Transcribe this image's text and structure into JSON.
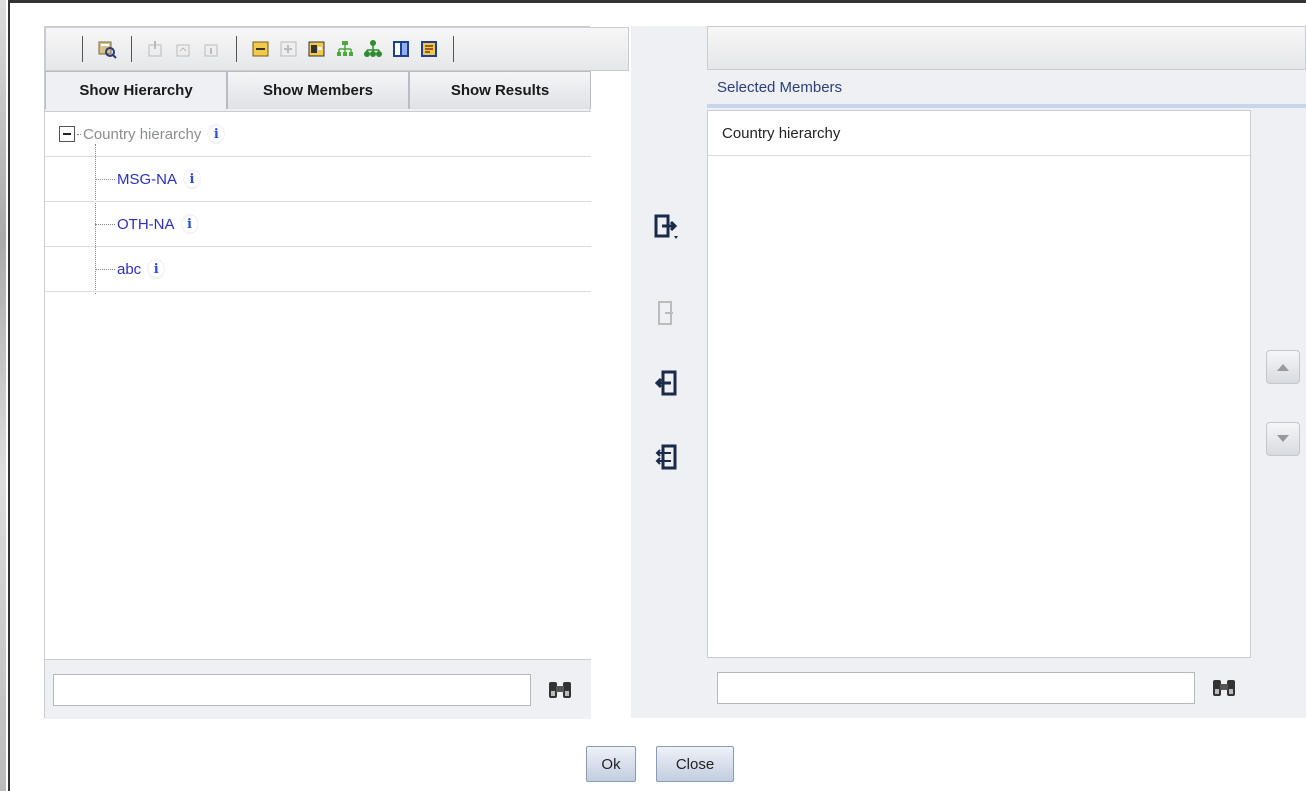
{
  "toolbar": {
    "icons": [
      "preview-icon",
      "move-first-icon",
      "move-up-icon",
      "move-last-icon",
      "collapse-icon",
      "expand-icon",
      "expand-all-icon",
      "hierarchy-icon",
      "tree-icon",
      "columns-icon",
      "report-icon"
    ]
  },
  "tabs": [
    {
      "label": "Show Hierarchy"
    },
    {
      "label": "Show Members"
    },
    {
      "label": "Show Results"
    }
  ],
  "tree": {
    "root": {
      "label": "Country hierarchy"
    },
    "children": [
      {
        "label": "MSG-NA"
      },
      {
        "label": "OTH-NA"
      },
      {
        "label": "abc"
      }
    ],
    "info_glyph": "i"
  },
  "left_search": {
    "value": "",
    "placeholder": ""
  },
  "selected": {
    "header": "Selected Members",
    "items": [
      "Country hierarchy"
    ]
  },
  "right_search": {
    "value": "",
    "placeholder": ""
  },
  "buttons": {
    "ok": "Ok",
    "close": "Close"
  },
  "colors": {
    "link": "#2b2fc2",
    "panel": "#eef0f3",
    "header_text": "#2a3f7a"
  }
}
